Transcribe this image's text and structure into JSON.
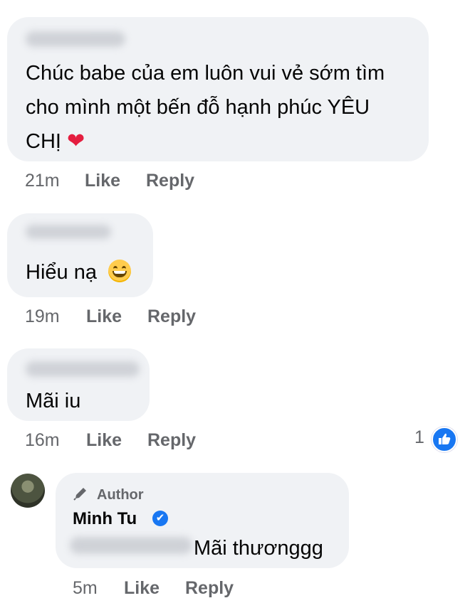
{
  "comments": [
    {
      "text_line1": "Chúc babe của em luôn vui vẻ sớm tìm",
      "text_line2": "cho mình một bến đỗ hạnh phúc YÊU",
      "text_line3": "CHỊ",
      "time": "21m",
      "like": "Like",
      "reply": "Reply"
    },
    {
      "text": "Hiểu nạ",
      "time": "19m",
      "like": "Like",
      "reply": "Reply"
    },
    {
      "text": "Mãi iu",
      "time": "16m",
      "like": "Like",
      "reply": "Reply",
      "reaction_count": "1"
    }
  ],
  "reply": {
    "badge": "Author",
    "author": "Minh Tu",
    "text": "Mãi thươnggg",
    "time": "5m",
    "like": "Like",
    "reply": "Reply"
  },
  "icons": {
    "heart": "❤",
    "verified": "✔",
    "thumbs_up": "👍"
  },
  "colors": {
    "bubble": "#f0f2f5",
    "meta_text": "#65676b",
    "accent_blue": "#1877f2",
    "heart_red": "#e41e3f"
  }
}
